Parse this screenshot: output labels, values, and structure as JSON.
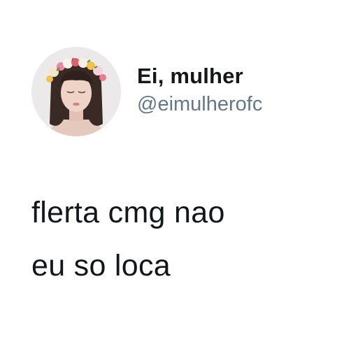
{
  "tweet": {
    "display_name": "Ei, mulher",
    "handle": "@eimulherofc",
    "lines": [
      "flerta cmg nao",
      "eu so loca"
    ]
  },
  "colors": {
    "text": "#14171a",
    "handle": "#657786",
    "background": "#ffffff"
  }
}
